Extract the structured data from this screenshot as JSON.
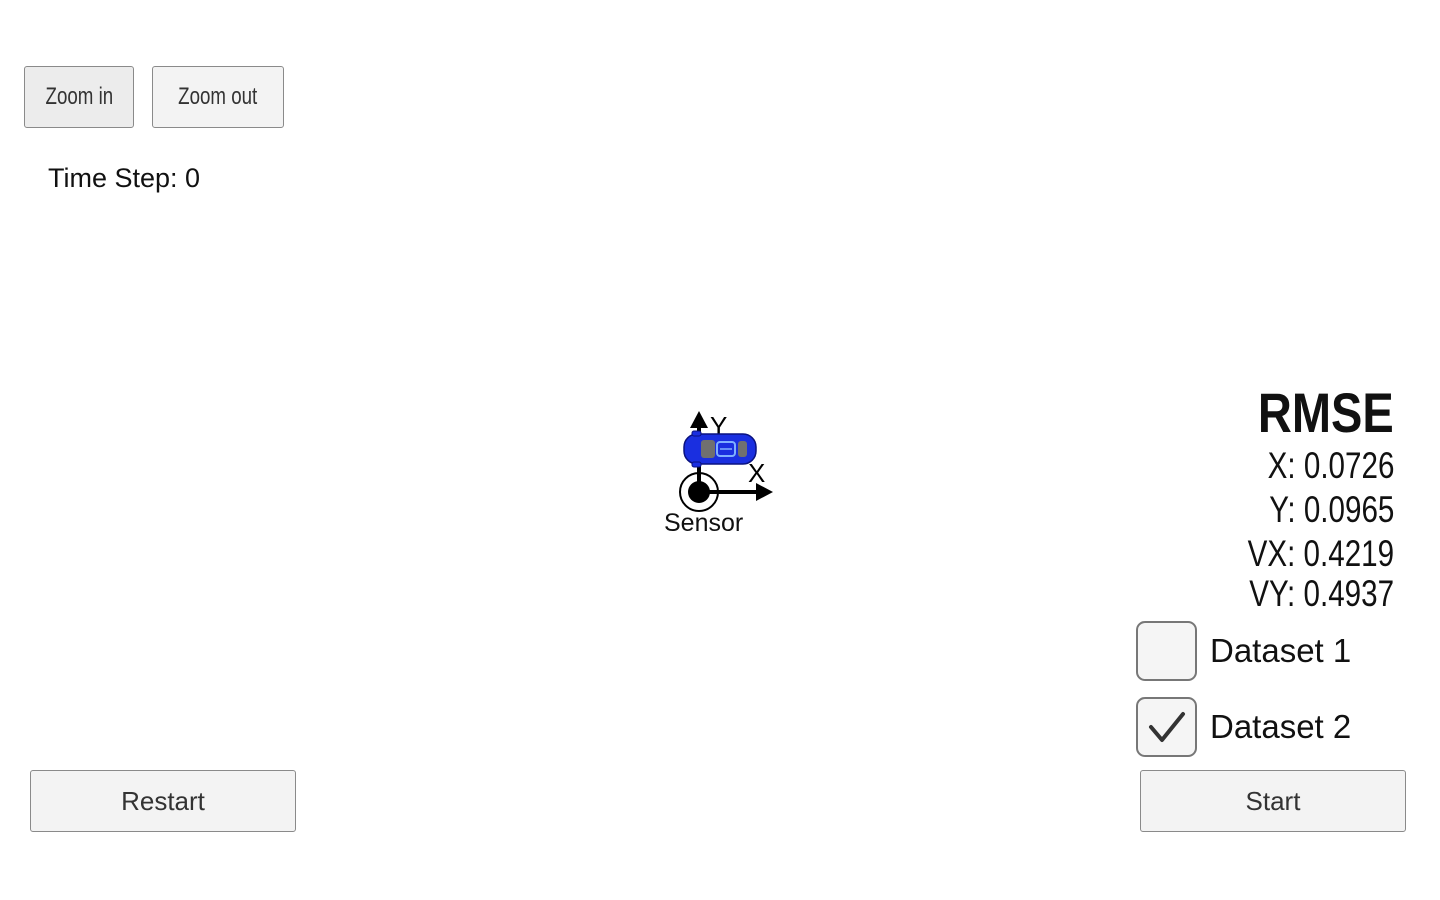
{
  "toolbar": {
    "zoom_in_label": "Zoom in",
    "zoom_out_label": "Zoom out"
  },
  "status": {
    "time_step_text": "Time Step: 0"
  },
  "scene": {
    "axis_y_label": "Y",
    "axis_x_label": "X",
    "sensor_label": "Sensor",
    "car_color": "#1a2fe0"
  },
  "rmse": {
    "title": "RMSE",
    "x": "X: 0.0726",
    "y": "Y: 0.0965",
    "vx": "VX: 0.4219",
    "vy": "VY: 0.4937"
  },
  "datasets": [
    {
      "label": "Dataset 1",
      "checked": false
    },
    {
      "label": "Dataset 2",
      "checked": true
    }
  ],
  "controls": {
    "restart_label": "Restart",
    "start_label": "Start"
  }
}
